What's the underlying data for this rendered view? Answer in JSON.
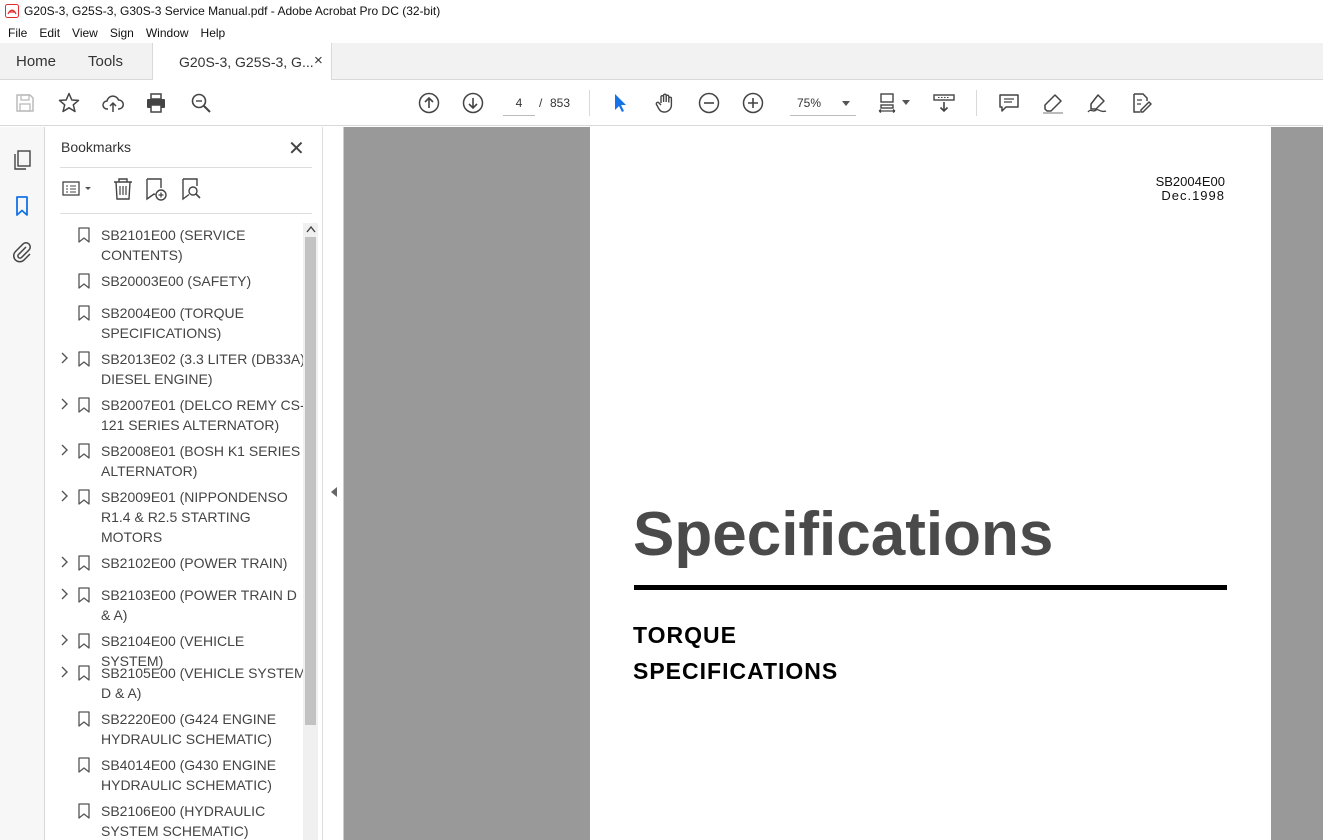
{
  "window": {
    "title": "G20S-3, G25S-3, G30S-3 Service Manual.pdf - Adobe Acrobat Pro DC (32-bit)"
  },
  "menu": [
    "File",
    "Edit",
    "View",
    "Sign",
    "Window",
    "Help"
  ],
  "tabs": {
    "home": "Home",
    "tools": "Tools",
    "document": "G20S-3, G25S-3, G...",
    "close": "×"
  },
  "toolbar": {
    "current_page": "4",
    "page_separator": "/",
    "total_pages": "853",
    "zoom": "75%"
  },
  "bookmarks": {
    "title": "Bookmarks",
    "close": "✕",
    "items": [
      {
        "label": "SB2101E00 (SERVICE CONTENTS)",
        "expandable": false
      },
      {
        "label": "SB20003E00 (SAFETY)",
        "expandable": false
      },
      {
        "label": "SB2004E00 (TORQUE SPECIFICATIONS)",
        "expandable": false
      },
      {
        "label": "SB2013E02 (3.3 LITER (DB33A) DIESEL ENGINE)",
        "expandable": true
      },
      {
        "label": "SB2007E01 (DELCO REMY CS-121 SERIES ALTERNATOR)",
        "expandable": true
      },
      {
        "label": "SB2008E01 (BOSH K1 SERIES ALTERNATOR)",
        "expandable": true
      },
      {
        "label": "SB2009E01 (NIPPONDENSO R1.4 & R2.5 STARTING MOTORS",
        "expandable": true
      },
      {
        "label": "SB2102E00 (POWER TRAIN)",
        "expandable": true
      },
      {
        "label": "SB2103E00 (POWER TRAIN D & A)",
        "expandable": true
      },
      {
        "label": "SB2104E00 (VEHICLE SYSTEM)",
        "expandable": true
      },
      {
        "label": "SB2105E00 (VEHICLE SYSTEM D & A)",
        "expandable": true
      },
      {
        "label": "SB2220E00 (G424 ENGINE HYDRAULIC SCHEMATIC)",
        "expandable": false
      },
      {
        "label": "SB4014E00 (G430 ENGINE HYDRAULIC SCHEMATIC)",
        "expandable": false
      },
      {
        "label": "SB2106E00 (HYDRAULIC SYSTEM SCHEMATIC)",
        "expandable": false
      }
    ]
  },
  "document": {
    "code": "SB2004E00",
    "date": "Dec.1998",
    "heading": "Specifications",
    "subtitle_line1": "TORQUE",
    "subtitle_line2": "SPECIFICATIONS"
  },
  "colors": {
    "accent": "#1473e6",
    "acrobat_red": "#e12f2f",
    "doc_background": "#999999",
    "heading_gray": "#4a4a4a"
  }
}
